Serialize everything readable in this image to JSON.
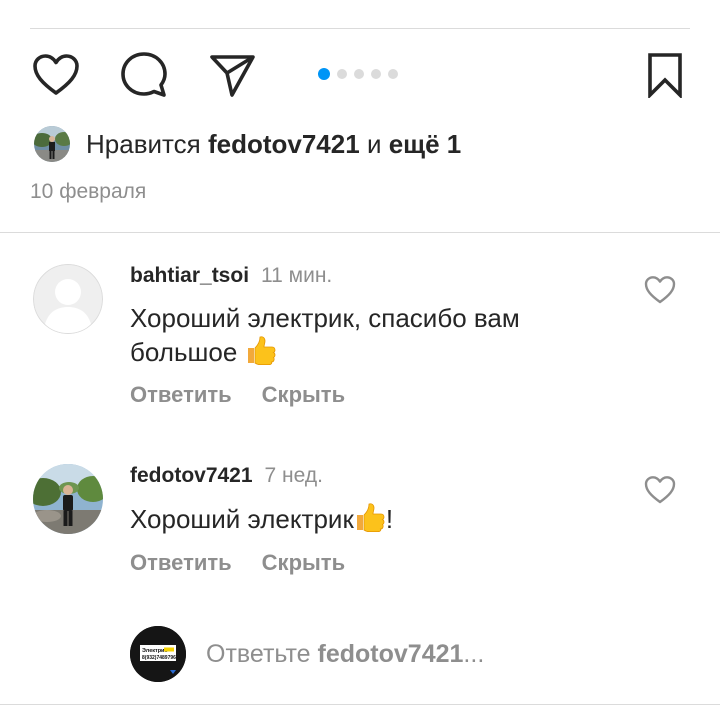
{
  "post": {
    "carousel": {
      "count": 5,
      "active": 0
    },
    "likes": {
      "prefix": "Нравится",
      "user": "fedotov7421",
      "suffix_and": "и",
      "suffix_more": "ещё 1"
    },
    "date": "10 февраля"
  },
  "comments": [
    {
      "username": "bahtiar_tsoi",
      "time": "11 мин.",
      "text": "Хороший электрик, спасибо вам большое",
      "emoji": "thumbs-up",
      "reply_label": "Ответить",
      "hide_label": "Скрыть"
    },
    {
      "username": "fedotov7421",
      "time": "7 нед.",
      "text": "Хороший электрик",
      "emoji": "thumbs-up",
      "text_end": "!",
      "reply_label": "Ответить",
      "hide_label": "Скрыть"
    }
  ],
  "reply_box": {
    "prefix": "Ответьте",
    "user": "fedotov7421",
    "ellipsis": "...",
    "avatar_text": "Электрик",
    "avatar_phone": "8(932)7489796"
  },
  "colors": {
    "accent": "#0095f6",
    "text": "#262626",
    "muted": "#8e8e8e",
    "divider": "#dbdbdb"
  }
}
